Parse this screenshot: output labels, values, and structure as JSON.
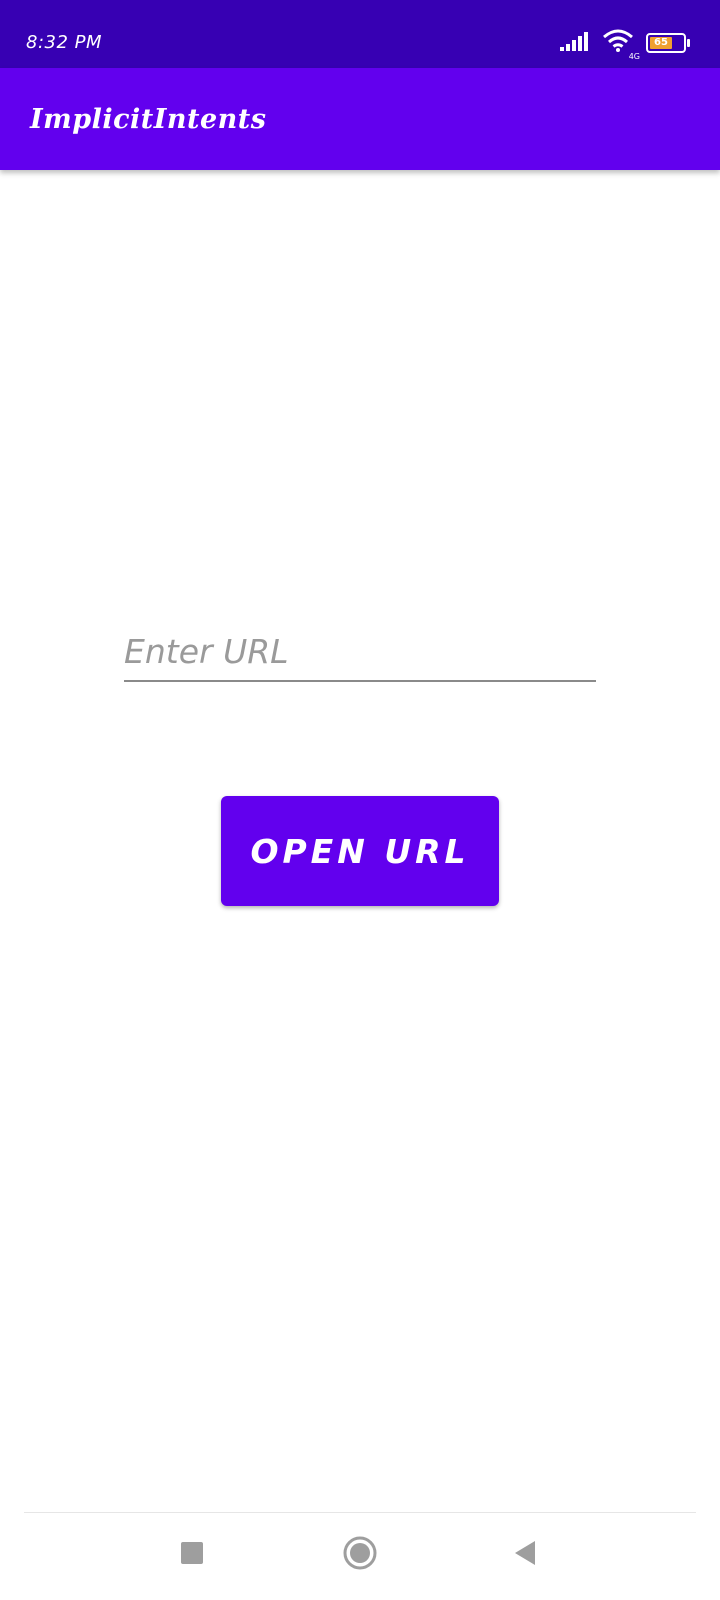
{
  "status_bar": {
    "time": "8:32 PM",
    "battery_level": "65",
    "network_badge": "4G",
    "icons": [
      "signal-icon",
      "wifi-icon",
      "battery-icon"
    ]
  },
  "app_bar": {
    "title": "ImplicitIntents"
  },
  "main": {
    "url_input": {
      "placeholder": "Enter URL",
      "value": ""
    },
    "open_button_label": "OPEN URL"
  },
  "nav_bar": {
    "buttons": [
      "recents-square-icon",
      "home-circle-icon",
      "back-triangle-icon"
    ]
  },
  "colors": {
    "status_bar": "#3700b3",
    "primary": "#6200ee",
    "background": "#ffffff",
    "placeholder": "#9a9a9a",
    "underline": "#8a8a8a"
  }
}
